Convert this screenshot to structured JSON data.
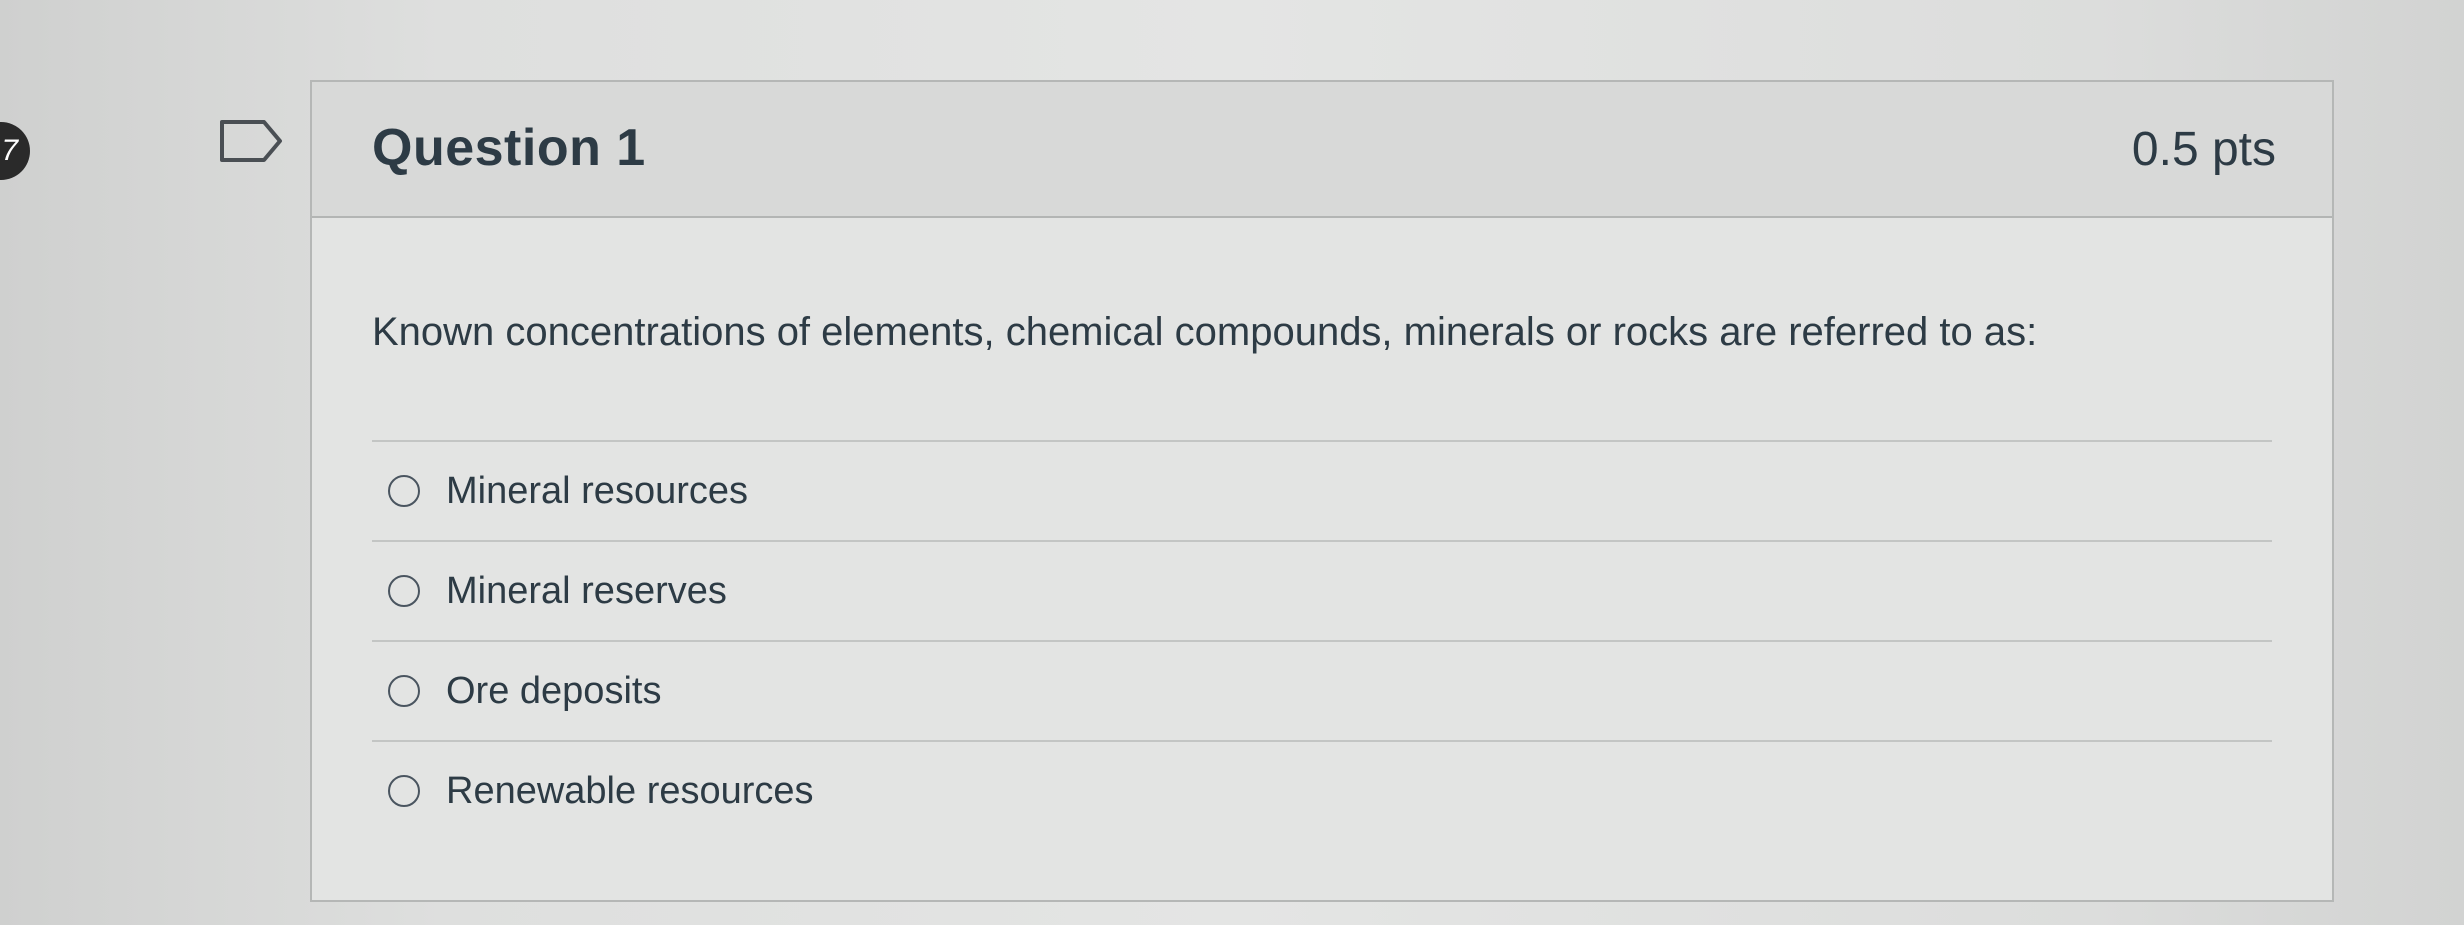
{
  "sidebar": {
    "question_number_badge": "7"
  },
  "question": {
    "title": "Question 1",
    "points": "0.5 pts",
    "text": "Known concentrations of elements, chemical compounds, minerals or rocks are referred to as:",
    "answers": [
      {
        "label": "Mineral resources",
        "selected": false
      },
      {
        "label": "Mineral reserves",
        "selected": false
      },
      {
        "label": "Ore deposits",
        "selected": false
      },
      {
        "label": "Renewable resources",
        "selected": false
      }
    ]
  },
  "icons": {
    "flag": "flag-question-icon",
    "radio": "radio-unselected-icon"
  },
  "colors": {
    "text": "#2d3b45",
    "header_bg": "#d8d9d8",
    "card_bg": "#e3e4e3",
    "border": "#b5b7b6"
  }
}
